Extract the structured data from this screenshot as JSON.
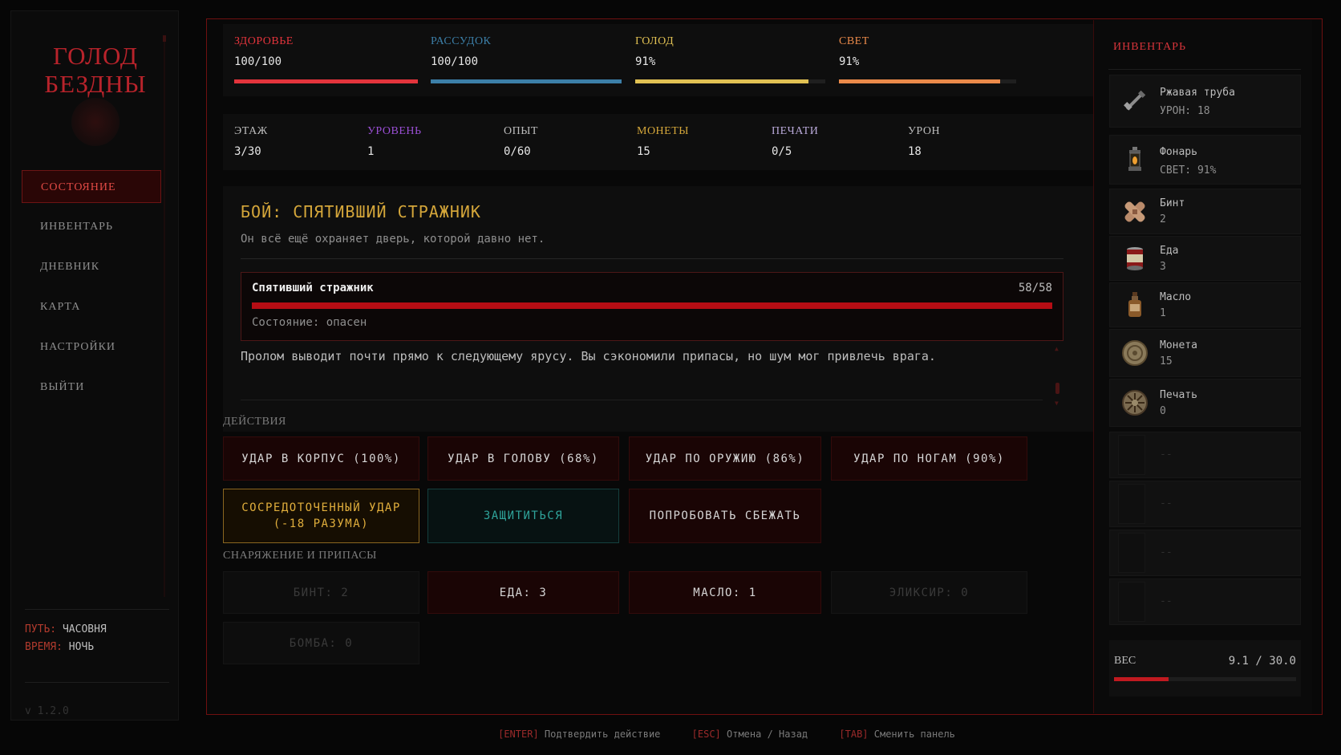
{
  "game": {
    "title_line1": "ГОЛОД",
    "title_line2": "БЕЗДНЫ",
    "version": "v 1.2.0"
  },
  "nav": {
    "items": [
      {
        "label": "СОСТОЯНИЕ",
        "active": true
      },
      {
        "label": "ИНВЕНТАРЬ",
        "active": false
      },
      {
        "label": "ДНЕВНИК",
        "active": false
      },
      {
        "label": "КАРТА",
        "active": false
      },
      {
        "label": "НАСТРОЙКИ",
        "active": false
      },
      {
        "label": "ВЫЙТИ",
        "active": false
      }
    ]
  },
  "location": {
    "path_label": "ПУТЬ:",
    "path_value": "ЧАСОВНЯ",
    "time_label": "ВРЕМЯ:",
    "time_value": "НОЧЬ"
  },
  "stats": [
    {
      "label": "ЗДОРОВЬЕ",
      "value": "100/100",
      "fill_fraction": 1.0,
      "color": "#e3343c"
    },
    {
      "label": "РАССУДОК",
      "value": "100/100",
      "fill_fraction": 1.0,
      "color": "#3c7fa8"
    },
    {
      "label": "ГОЛОД",
      "value": "91%",
      "fill_fraction": 0.91,
      "color": "#e1c153"
    },
    {
      "label": "СВЕТ",
      "value": "91%",
      "fill_fraction": 0.91,
      "color": "#eb8a4a"
    }
  ],
  "info": [
    {
      "label": "ЭТАЖ",
      "value": "3/30",
      "color": "#bdbdbd"
    },
    {
      "label": "УРОВЕНЬ",
      "value": "1",
      "color": "#9a4fd4"
    },
    {
      "label": "ОПЫТ",
      "value": "0/60",
      "color": "#bdbdbd"
    },
    {
      "label": "МОНЕТЫ",
      "value": "15",
      "color": "#d4a63a"
    },
    {
      "label": "ПЕЧАТИ",
      "value": "0/5",
      "color": "#b9a9d9"
    },
    {
      "label": "УРОН",
      "value": "18",
      "color": "#bdbdbd"
    }
  ],
  "combat": {
    "title": "БОЙ: СПЯТИВШИЙ СТРАЖНИК",
    "description": "Он всё ещё охраняет дверь, которой давно нет.",
    "enemy_name": "Спятивший стражник",
    "enemy_hp": "58/58",
    "enemy_hp_fraction": 1.0,
    "enemy_state": "Состояние: опасен",
    "log": "Пролом выводит почти прямо к следующему ярусу. Вы сэкономили припасы, но шум мог привлечь врага."
  },
  "actions": {
    "label": "ДЕЙСТВИЯ",
    "body": "УДАР В КОРПУС (100%)",
    "head": "УДАР В ГОЛОВУ (68%)",
    "weapon": "УДАР ПО ОРУЖИЮ (86%)",
    "legs": "УДАР ПО НОГАМ (90%)",
    "focused_line1": "СОСРЕДОТОЧЕННЫЙ УДАР",
    "focused_line2": "(-18 РАЗУМА)",
    "defend": "ЗАЩИТИТЬСЯ",
    "flee": "ПОПРОБОВАТЬ СБЕЖАТЬ"
  },
  "supplies": {
    "label": "СНАРЯЖЕНИЕ И ПРИПАСЫ",
    "bandage": "БИНТ: 2",
    "food": "ЕДА: 3",
    "oil": "МАСЛО: 1",
    "elixir": "ЭЛИКСИР: 0",
    "bomb": "БОМБА: 0"
  },
  "inventory": {
    "title": "ИНВЕНТАРЬ",
    "items": [
      {
        "name": "Ржавая труба",
        "detail": "УРОН: 18",
        "icon": "pipe-icon"
      },
      {
        "name": "Фонарь",
        "detail": "СВЕТ: 91%",
        "icon": "lantern-icon"
      },
      {
        "name": "Бинт",
        "detail": "2",
        "icon": "bandage-icon"
      },
      {
        "name": "Еда",
        "detail": "3",
        "icon": "can-icon"
      },
      {
        "name": "Масло",
        "detail": "1",
        "icon": "oil-bottle-icon"
      },
      {
        "name": "Монета",
        "detail": "15",
        "icon": "coin-icon"
      },
      {
        "name": "Печать",
        "detail": "0",
        "icon": "seal-icon"
      }
    ],
    "empty_slots": [
      "--",
      "--",
      "--",
      "--"
    ],
    "weight_label": "ВЕС",
    "weight_value": "9.1 / 30.0",
    "weight_fraction": 0.3
  },
  "hints": [
    {
      "key": "[ENTER]",
      "text": "Подтвердить действие"
    },
    {
      "key": "[ESC]",
      "text": "Отмена / Назад"
    },
    {
      "key": "[TAB]",
      "text": "Сменить панель"
    }
  ]
}
